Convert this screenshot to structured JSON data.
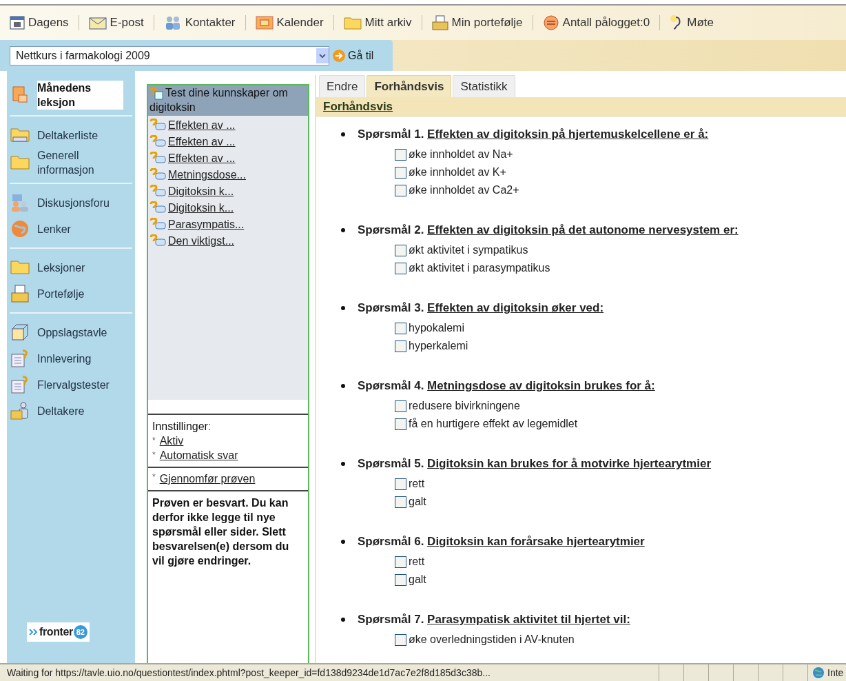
{
  "toolbar": {
    "items": [
      {
        "label": "Dagens"
      },
      {
        "label": "E-post"
      },
      {
        "label": "Kontakter"
      },
      {
        "label": "Kalender"
      },
      {
        "label": "Mitt arkiv"
      },
      {
        "label": "Min portefølje"
      },
      {
        "label": "Antall pålogget:0"
      },
      {
        "label": "Møte"
      }
    ]
  },
  "room_select": {
    "value": "Nettkurs i farmakologi 2009",
    "go_button": "Gå til"
  },
  "sidebar": {
    "groups": [
      [
        {
          "label": "Månedens leksjon",
          "selected": true
        }
      ],
      [
        {
          "label": "Deltakerliste",
          "selected": false
        },
        {
          "label": "Generell informasjon",
          "selected": false
        }
      ],
      [
        {
          "label": "Diskusjonsforu",
          "selected": false
        },
        {
          "label": "Lenker",
          "selected": false
        }
      ],
      [
        {
          "label": "Leksjoner",
          "selected": false
        },
        {
          "label": "Portefølje",
          "selected": false
        }
      ],
      [
        {
          "label": "Oppslagstavle",
          "selected": false
        },
        {
          "label": "Innlevering",
          "selected": false
        },
        {
          "label": "Flervalgstester",
          "selected": false
        },
        {
          "label": "Deltakere",
          "selected": false
        }
      ]
    ],
    "logo": {
      "text": "fronter",
      "badge": "82"
    }
  },
  "test_panel": {
    "title": "Test dine kunnskaper om digitoksin",
    "pages": [
      "Effekten av ...",
      "Effekten av ...",
      "Effekten av ...",
      "Metningsdose...",
      "Digitoksin k...",
      "Digitoksin k...",
      "Parasympatis...",
      "Den viktigst..."
    ],
    "settings_label": "Innstillinger",
    "settings_label_colon": ":",
    "settings": [
      {
        "bullet": "*",
        "label": "Aktiv"
      },
      {
        "bullet": "*",
        "label": "Automatisk svar"
      }
    ],
    "action": {
      "bullet": "*",
      "label": "Gjennomfør prøven"
    },
    "notice": "Prøven er besvart. Du kan derfor ikke legge til nye spørsmål eller sider. Slett besvarelsen(e) dersom du vil gjøre endringer."
  },
  "tabs": [
    {
      "label": "Endre",
      "selected": false
    },
    {
      "label": "Forhåndsvis",
      "selected": true
    },
    {
      "label": "Statistikk",
      "selected": false
    }
  ],
  "section_title": "Forhåndsvis",
  "questions": [
    {
      "number": "Spørsmål 1.",
      "title": "Effekten av digitoksin på hjertemuskelcellene er å:",
      "options": [
        {
          "label": "øke innholdet av Na+",
          "checked": false
        },
        {
          "label": "øke innholdet av K+",
          "checked": false
        },
        {
          "label": "øke innholdet av Ca2+",
          "checked": false
        }
      ]
    },
    {
      "number": "Spørsmål 2.",
      "title": "Effekten av digitoksin på det autonome nervesystem er:",
      "options": [
        {
          "label": "økt aktivitet i sympatikus",
          "checked": false
        },
        {
          "label": "økt aktivitet i parasympatikus",
          "checked": false
        }
      ]
    },
    {
      "number": "Spørsmål 3.",
      "title": "Effekten av digitoksin øker ved:",
      "options": [
        {
          "label": "hypokalemi",
          "checked": false
        },
        {
          "label": "hyperkalemi",
          "checked": false
        }
      ]
    },
    {
      "number": "Spørsmål 4.",
      "title": "Metningsdose av digitoksin brukes for å:",
      "options": [
        {
          "label": "redusere bivirkningene",
          "checked": false
        },
        {
          "label": "få en hurtigere effekt av legemidlet",
          "checked": false
        }
      ]
    },
    {
      "number": "Spørsmål 5.",
      "title": "Digitoksin kan brukes for å motvirke hjertearytmier",
      "options": [
        {
          "label": "rett",
          "checked": false
        },
        {
          "label": "galt",
          "checked": false
        }
      ]
    },
    {
      "number": "Spørsmål 6.",
      "title": "Digitoksin kan forårsake hjertearytmier",
      "options": [
        {
          "label": "rett",
          "checked": false
        },
        {
          "label": "galt",
          "checked": false
        }
      ]
    },
    {
      "number": "Spørsmål 7.",
      "title": "Parasympatisk aktivitet til hjertet vil:",
      "options": [
        {
          "label": "øke overledningstiden i AV-knuten",
          "checked": false
        }
      ]
    }
  ],
  "status_bar": {
    "text": "Waiting for https://tavle.uio.no/questiontest/index.phtml?post_keeper_id=fd138d9234de1d7ac7e2f8d185d3c38b...",
    "zone": "Inte"
  }
}
